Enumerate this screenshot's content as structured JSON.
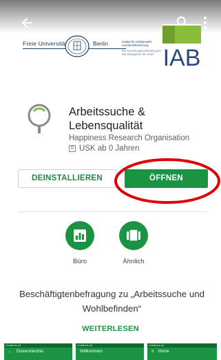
{
  "header": {
    "fu_left": "Freie Universität",
    "fu_right": "Berlin",
    "iab_line1": "Institut für Arbeitsmarkt-",
    "iab_line2": "und Berufsforschung",
    "iab_sub1": "Die Forschungseinrichtung der",
    "iab_sub2": "Bundesagentur für Arbeit",
    "iab_logo": "IAB"
  },
  "app": {
    "title_line1": "Arbeitssuche &",
    "title_line2": "Lebensqualität",
    "developer": "Happiness Research Organisation",
    "usk_badge": "0",
    "rating": "USK ab 0 Jahren"
  },
  "buttons": {
    "uninstall": "DEINSTALLIEREN",
    "open": "ÖFFNEN"
  },
  "chips": [
    {
      "label": "Büro",
      "icon": "bar-chart-icon"
    },
    {
      "label": "Ähnlich",
      "icon": "cards-icon"
    }
  ],
  "description": {
    "text": "Beschäftigtenbefragung zu „Arbeitssuche und Wohlbefinden“",
    "read_more": "WEITERLESEN"
  },
  "screenshots": [
    {
      "status": "Vodafone.de",
      "bar_icon": "←",
      "title": "Einverständnis"
    },
    {
      "status": "Vodafone.de",
      "bar_icon": "",
      "title": "Willkommen"
    },
    {
      "status": "Vodafone.de",
      "bar_icon": "≡",
      "title": "Home"
    }
  ],
  "colors": {
    "accent": "#1a9443",
    "highlight": "#e00000"
  }
}
